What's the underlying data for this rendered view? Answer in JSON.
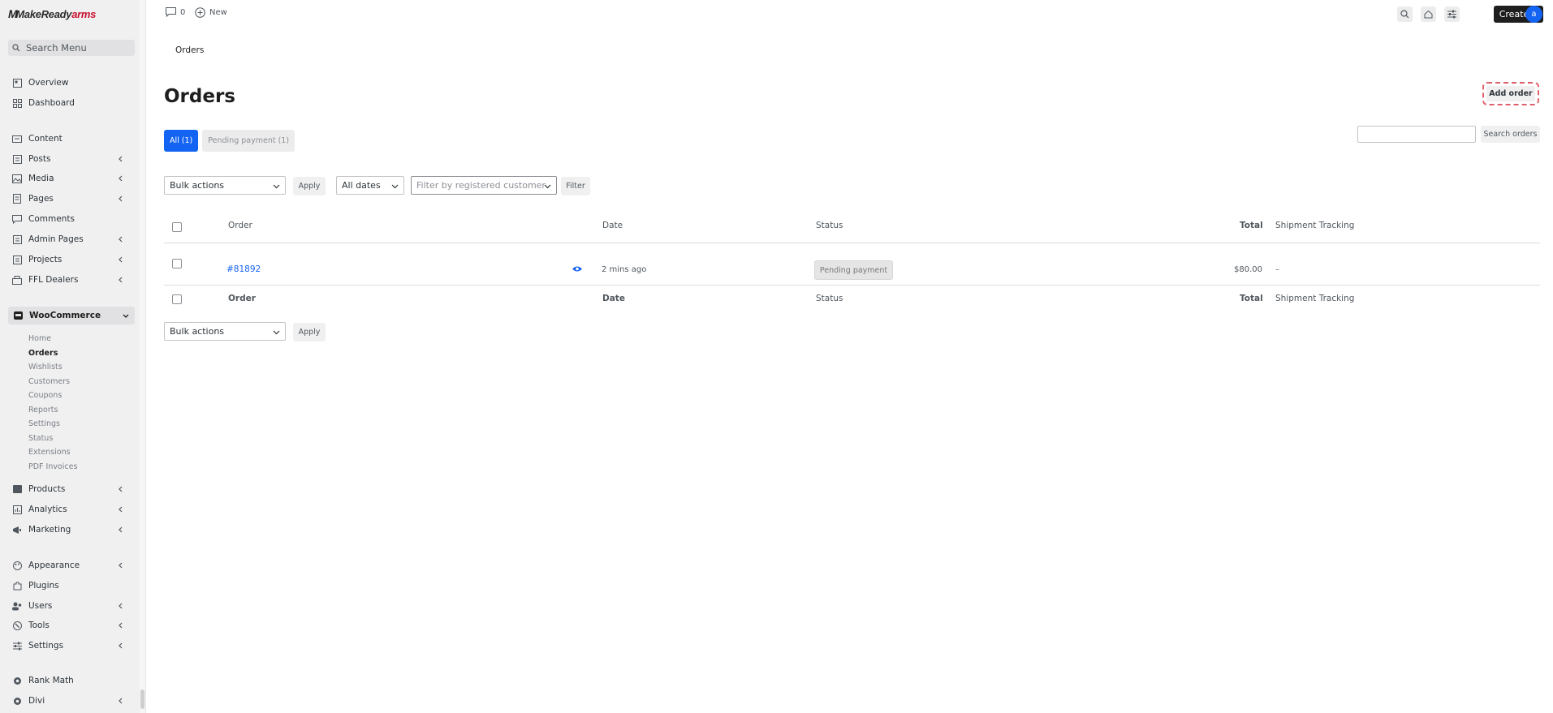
{
  "brand": {
    "logo_main": "MakeReady",
    "logo_accent": "arms",
    "logo_m": "M"
  },
  "sidebar": {
    "search_placeholder": "Search Menu",
    "items_top": [
      {
        "label": "Overview",
        "icon": "overview-icon"
      },
      {
        "label": "Dashboard",
        "icon": "dashboard-icon"
      }
    ],
    "items_content": [
      {
        "label": "Content",
        "icon": "content-icon",
        "chevron": false
      },
      {
        "label": "Posts",
        "icon": "posts-icon",
        "chevron": true
      },
      {
        "label": "Media",
        "icon": "media-icon",
        "chevron": true
      },
      {
        "label": "Pages",
        "icon": "pages-icon",
        "chevron": true
      },
      {
        "label": "Comments",
        "icon": "comments-icon",
        "chevron": false
      },
      {
        "label": "Admin Pages",
        "icon": "admin-pages-icon",
        "chevron": true
      },
      {
        "label": "Projects",
        "icon": "projects-icon",
        "chevron": true
      },
      {
        "label": "FFL Dealers",
        "icon": "ffl-dealers-icon",
        "chevron": true
      }
    ],
    "woocommerce": {
      "label": "WooCommerce",
      "subitems": [
        "Home",
        "Orders",
        "Wishlists",
        "Customers",
        "Coupons",
        "Reports",
        "Settings",
        "Status",
        "Extensions",
        "PDF Invoices"
      ],
      "active": "Orders"
    },
    "items_store": [
      {
        "label": "Products",
        "icon": "products-icon",
        "chevron": true
      },
      {
        "label": "Analytics",
        "icon": "analytics-icon",
        "chevron": true
      },
      {
        "label": "Marketing",
        "icon": "marketing-icon",
        "chevron": true
      }
    ],
    "items_admin": [
      {
        "label": "Appearance",
        "icon": "appearance-icon",
        "chevron": true
      },
      {
        "label": "Plugins",
        "icon": "plugins-icon",
        "chevron": false
      },
      {
        "label": "Users",
        "icon": "users-icon",
        "chevron": true
      },
      {
        "label": "Tools",
        "icon": "tools-icon",
        "chevron": true
      },
      {
        "label": "Settings",
        "icon": "settings-icon",
        "chevron": true
      }
    ],
    "items_bottom": [
      {
        "label": "Rank Math",
        "icon": "rank-math-icon",
        "chevron": false
      },
      {
        "label": "Divi",
        "icon": "divi-icon",
        "chevron": true
      }
    ]
  },
  "topbar": {
    "comments_count": "0",
    "new_label": "New",
    "create_label": "Create",
    "avatar_letter": "a"
  },
  "breadcrumb": "Orders",
  "page": {
    "title": "Orders",
    "add_order_label": "Add order",
    "views": [
      {
        "label": "All (1)",
        "active": true
      },
      {
        "label": "Pending payment (1)",
        "active": false
      }
    ],
    "search_value": "",
    "search_button": "Search orders",
    "bulk_actions": "Bulk actions",
    "apply": "Apply",
    "dates": "All dates",
    "customer_placeholder": "Filter by registered customer",
    "filter": "Filter"
  },
  "table": {
    "columns": [
      "Order",
      "Date",
      "Status",
      "Total",
      "Shipment Tracking"
    ],
    "rows": [
      {
        "order": "#81892",
        "date": "2 mins ago",
        "status": "Pending payment",
        "total": "$80.00",
        "tracking": "–"
      }
    ]
  },
  "colors": {
    "accent": "#1464f4",
    "create_bg": "#1e1e1e",
    "brand_red": "#c8102e"
  }
}
